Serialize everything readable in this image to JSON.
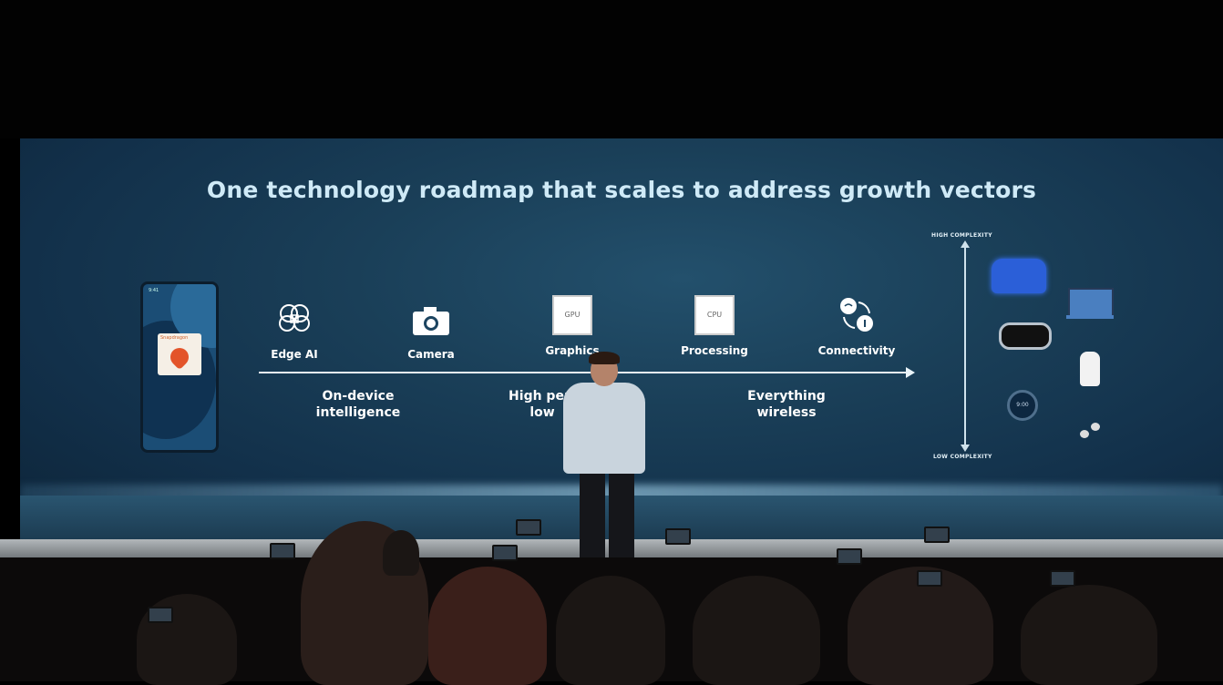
{
  "slide": {
    "title": "One technology roadmap that scales to address growth vectors",
    "phone": {
      "status_time": "9:41",
      "chip_label": "Snapdragon"
    },
    "features": [
      {
        "label": "Edge AI",
        "icon": "brain-icon"
      },
      {
        "label": "Camera",
        "icon": "camera-icon"
      },
      {
        "label": "Graphics",
        "icon": "gpu-chip-icon",
        "chip_text": "GPU"
      },
      {
        "label": "Processing",
        "icon": "cpu-chip-icon",
        "chip_text": "CPU"
      },
      {
        "label": "Connectivity",
        "icon": "wireless-icon"
      }
    ],
    "subtitles": [
      {
        "line1": "On-device",
        "line2": "intelligence"
      },
      {
        "line1": "High perf",
        "line2": "low"
      },
      {
        "line1": "Everything",
        "line2": "wireless"
      }
    ],
    "complexity": {
      "high": "HIGH COMPLEXITY",
      "low": "LOW COMPLEXITY"
    },
    "devices": [
      "car-icon",
      "laptop-icon",
      "xr-goggles-icon",
      "smart-speaker-icon",
      "smartwatch-icon",
      "earbuds-icon"
    ],
    "watch_text": "9:00"
  }
}
